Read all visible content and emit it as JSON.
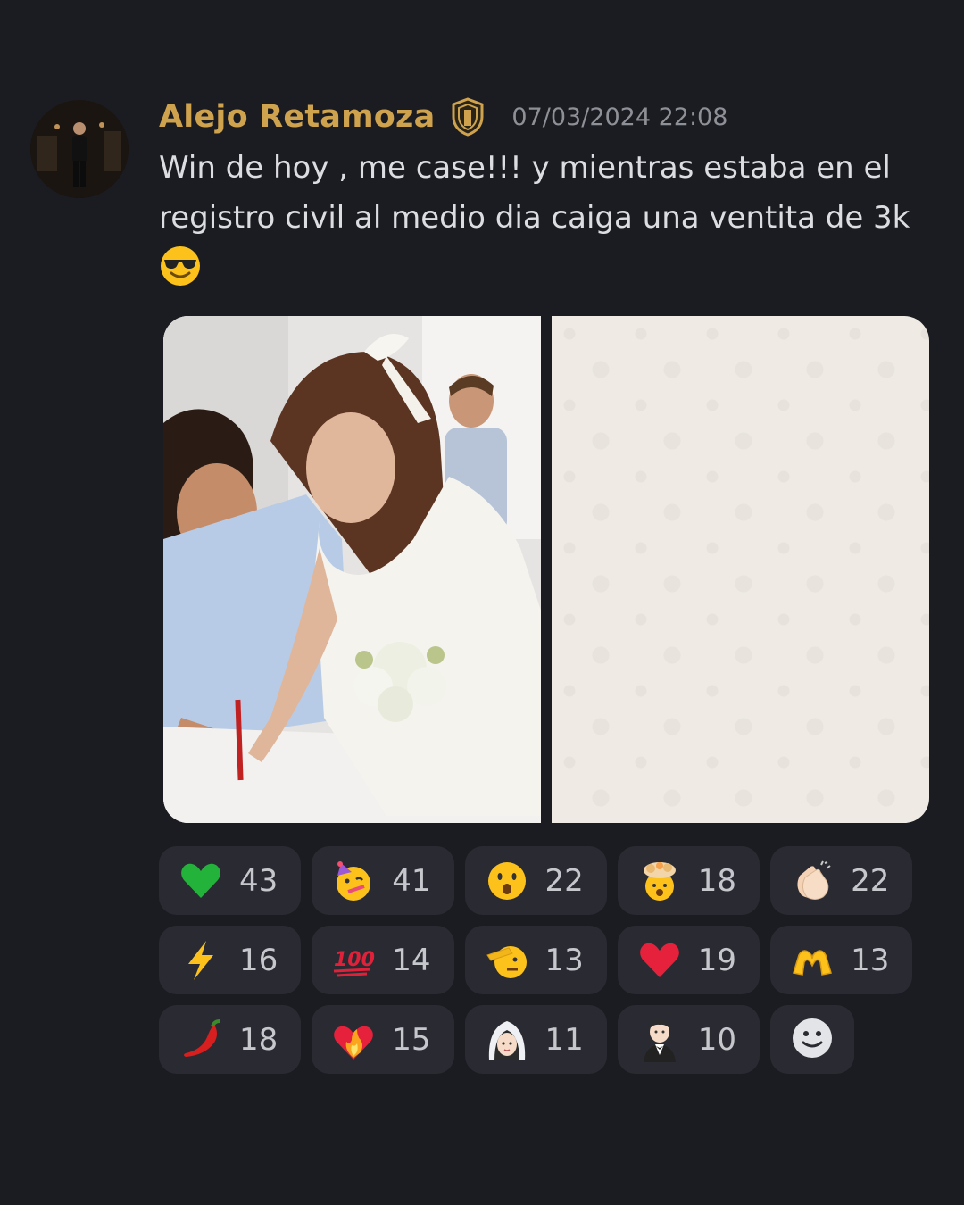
{
  "message": {
    "author": "Alejo Retamoza",
    "timestamp": "07/03/2024 22:08",
    "text": "Win de hoy , me case!!! y mientras estaba en el registro civil al medio dia caiga una ventita de 3k",
    "emoji": "smiling-face-with-sunglasses-icon"
  },
  "colors": {
    "author": "#cfa24d",
    "background": "#1b1c22",
    "reaction_bg": "#2a2b32"
  },
  "reactions": [
    [
      {
        "emoji": "green-heart-icon",
        "count": "43"
      },
      {
        "emoji": "partying-face-icon",
        "count": "41"
      },
      {
        "emoji": "hushed-face-icon",
        "count": "22"
      },
      {
        "emoji": "exploding-head-icon",
        "count": "18"
      },
      {
        "emoji": "clapping-hands-icon",
        "count": "22"
      }
    ],
    [
      {
        "emoji": "lightning-icon",
        "count": "16"
      },
      {
        "emoji": "hundred-points-icon",
        "count": "14"
      },
      {
        "emoji": "saluting-face-icon",
        "count": "13"
      },
      {
        "emoji": "red-heart-icon",
        "count": "19"
      },
      {
        "emoji": "heart-hands-icon",
        "count": "13"
      }
    ],
    [
      {
        "emoji": "hot-pepper-icon",
        "count": "18"
      },
      {
        "emoji": "heart-on-fire-icon",
        "count": "15"
      },
      {
        "emoji": "bride-with-veil-icon",
        "count": "11"
      },
      {
        "emoji": "groom-in-tuxedo-icon",
        "count": "10"
      }
    ]
  ]
}
